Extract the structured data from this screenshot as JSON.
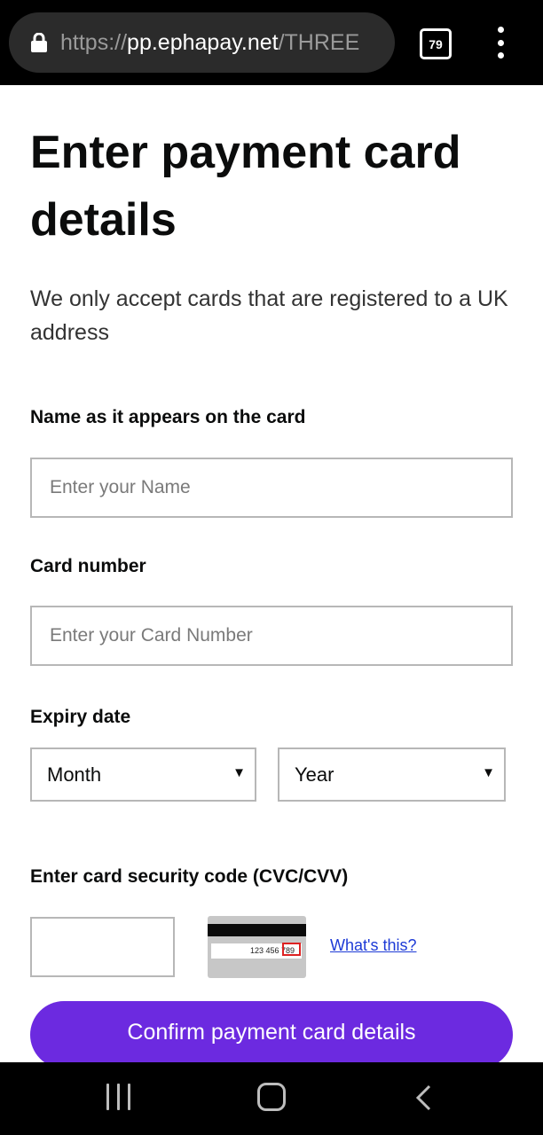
{
  "browser": {
    "url_scheme": "https://",
    "url_host": "pp.ephapay.net",
    "url_path": "/THREE",
    "tab_count": "79"
  },
  "page": {
    "title": "Enter payment card details",
    "intro": "We only accept cards that are registered to a UK address",
    "name_label": "Name as it appears on the card",
    "name_placeholder": "Enter your Name",
    "card_label": "Card number",
    "card_placeholder": "Enter your Card Number",
    "expiry_label": "Expiry date",
    "month_value": "Month",
    "year_value": "Year",
    "cvc_label": "Enter card security code (CVC/CVV)",
    "card_image_digits": "123 456 789",
    "whats_this": "What's this?",
    "confirm_label": "Confirm payment card details"
  },
  "colors": {
    "accent": "#6c2ae0",
    "link": "#1d3ad6"
  }
}
